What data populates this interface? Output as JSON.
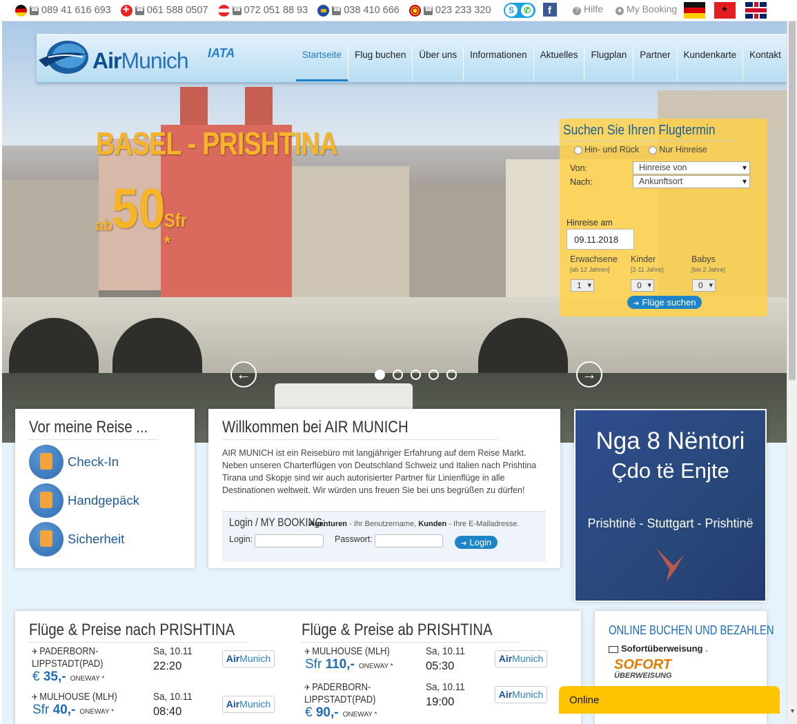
{
  "topbar": {
    "phones": [
      {
        "country": "de",
        "number": "089 41 616 693"
      },
      {
        "country": "ch",
        "number": "061 588 0507"
      },
      {
        "country": "at",
        "number": "072 051 88 93"
      },
      {
        "country": "xk",
        "number": "038 410 666"
      },
      {
        "country": "mk",
        "number": "023 233 320"
      }
    ],
    "help": "Hilfe",
    "my_booking": "My Booking"
  },
  "header": {
    "logo_air": "Air",
    "logo_munich": "Munich",
    "iata": "IATA",
    "nav": [
      "Startseite",
      "Flug buchen",
      "Über uns",
      "Informationen",
      "Aktuelles",
      "Flugplan",
      "Partner",
      "Kundenkarte",
      "Kontakt"
    ],
    "active_nav": "Startseite"
  },
  "promo": {
    "title": "BASEL - PRISHTINA",
    "ab": "ab",
    "price": "50",
    "currency": "Sfr *"
  },
  "slider": {
    "dot_count": 5,
    "active_dot": 1
  },
  "search": {
    "title": "Suchen Sie Ihren Flugtermin",
    "option_round": "Hin- und Rück",
    "option_oneway": "Nur Hinreise",
    "von_label": "Von:",
    "von_value": "Hinreise von",
    "nach_label": "Nach:",
    "nach_value": "Ankunftsort",
    "date_label": "Hinreise am",
    "date_value": "09.11.2018",
    "adults_label": "Erwachsene",
    "adults_hint": "[ab 12 Jahren]",
    "adults_value": "1",
    "kids_label": "Kinder",
    "kids_hint": "[2-11 Jahre]",
    "kids_value": "0",
    "babies_label": "Babys",
    "babies_hint": "[bis 2 Jahre]",
    "babies_value": "0",
    "submit": "Flüge suchen"
  },
  "before_trip": {
    "title": "Vor meine Reise ...",
    "items": [
      "Check-In",
      "Handgepäck",
      "Sicherheit"
    ]
  },
  "welcome": {
    "title": "Willkommen bei AIR MUNICH",
    "text": "AIR MUNICH ist ein Reisebüro mit langjähriger Erfahrung auf dem Reise Markt. Neben unseren Charterflügen von Deutschland Schweiz und Italien nach Prishtina Tirana und Skopje sind wir auch autorisierter Partner für Linienflüge in alle Destinationen weltweit. Wir würden uns freuen Sie bei uns begrüßen zu dürfen!",
    "login_title": "Login / MY BOOKING:",
    "hint_agents": "Agenturen",
    "hint_agents_text": " - Ihr Benutzername, ",
    "hint_customers": "Kunden",
    "hint_customers_text": " - Ihre E-Mailadresse.",
    "login_label": "Login:",
    "password_label": "Passwort:",
    "login_button": "Login"
  },
  "banner": {
    "line1": "Nga 8 Nëntori",
    "line2": "Çdo të Enjte",
    "line3": "Prishtinë - Stuttgart - Prishtinë"
  },
  "flights_to": {
    "title": "Flüge & Preise nach PRISHTINA",
    "rows": [
      {
        "route": "PADERBORN-LIPPSTADT(PAD)",
        "date": "Sa, 10.11",
        "time": "22:20",
        "currency": "€",
        "price": "35,-",
        "type": "ONEWAY *"
      },
      {
        "route": "MULHOUSE (MLH)",
        "date": "Sa, 10.11",
        "time": "08:40",
        "currency": "Sfr",
        "price": "40,-",
        "type": "ONEWAY *"
      }
    ]
  },
  "flights_from": {
    "title": "Flüge & Preise ab PRISHTINA",
    "rows": [
      {
        "route": "MULHOUSE (MLH)",
        "date": "Sa, 10.11",
        "time": "05:30",
        "currency": "Sfr",
        "price": "110,-",
        "type": "ONEWAY *"
      },
      {
        "route": "PADERBORN-LIPPSTADT(PAD)",
        "date": "Sa, 10.11",
        "time": "19:00",
        "currency": "€",
        "price": "90,-",
        "type": "ONEWAY *"
      }
    ]
  },
  "airline_logo": {
    "air": "Air",
    "munich": "Munich"
  },
  "payment": {
    "title": "ONLINE BUCHEN UND BEZAHLEN",
    "method": "Sofortüberweisung",
    "method_suffix": " .",
    "sofort_logo": "SOFORT",
    "sofort_sub": "ÜBERWEISUNG"
  },
  "chat": {
    "status": "Online"
  }
}
